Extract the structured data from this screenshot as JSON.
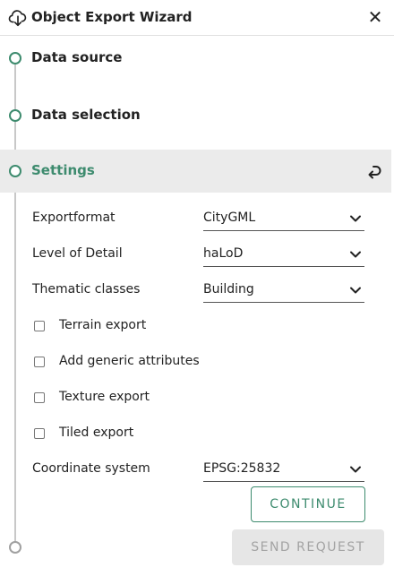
{
  "header": {
    "title": "Object Export Wizard",
    "download_icon": "cloud-download-icon",
    "close_icon": "close-icon"
  },
  "steps": [
    {
      "label": "Data source",
      "state": "done"
    },
    {
      "label": "Data selection",
      "state": "done"
    },
    {
      "label": "Settings",
      "state": "active"
    },
    {
      "label": "",
      "state": "pending"
    }
  ],
  "settings": {
    "fields": [
      {
        "label": "Exportformat",
        "value": "CityGML"
      },
      {
        "label": "Level of Detail",
        "value": "haLoD"
      },
      {
        "label": "Thematic classes",
        "value": "Building"
      }
    ],
    "checkboxes": [
      {
        "label": "Terrain export",
        "checked": false
      },
      {
        "label": "Add generic attributes",
        "checked": false
      },
      {
        "label": "Texture export",
        "checked": false
      },
      {
        "label": "Tiled export",
        "checked": false
      }
    ],
    "coordinate_system": {
      "label": "Coordinate system",
      "value": "EPSG:25832"
    }
  },
  "buttons": {
    "continue": "CONTINUE",
    "send_request": "SEND REQUEST"
  },
  "colors": {
    "accent": "#3d8b6e",
    "active_row_bg": "#ebebeb",
    "disabled_bg": "#e6e6e6",
    "disabled_text": "#a3a3a3"
  }
}
